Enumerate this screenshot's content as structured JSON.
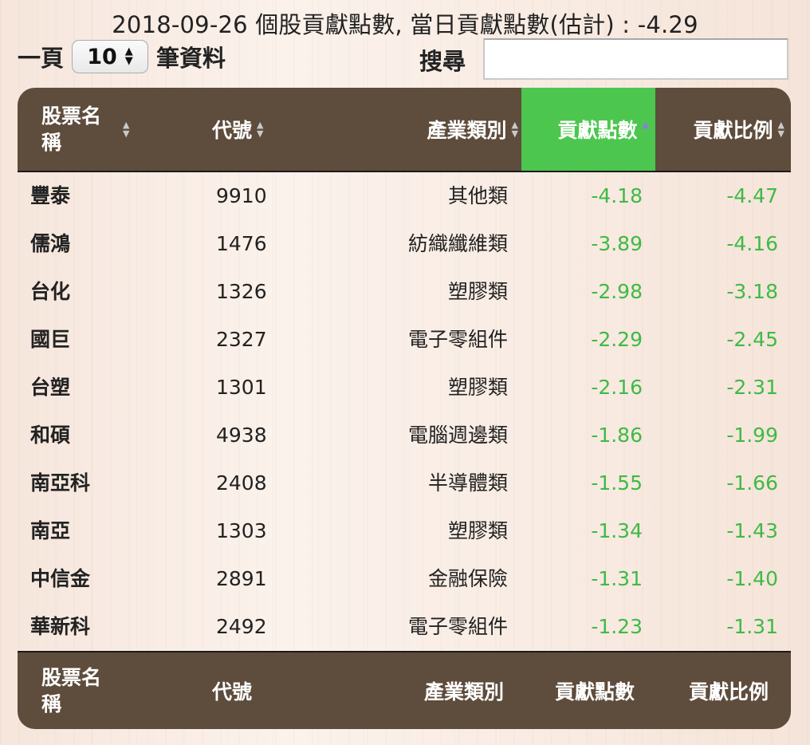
{
  "title": "2018-09-26 個股貢獻點數, 當日貢獻點數(估計) : -4.29",
  "controls": {
    "per_page_prefix": "一頁",
    "per_page_value": "10",
    "per_page_suffix": "筆資料",
    "search_label": "搜尋",
    "search_value": ""
  },
  "columns": {
    "name": "股票名稱",
    "code": "代號",
    "industry": "產業類別",
    "points": "貢獻點數",
    "ratio": "貢獻比例"
  },
  "sort": {
    "column": "points",
    "direction": "asc"
  },
  "colors": {
    "header_bg": "#5e4c3c",
    "active_header_bg": "#4cc64f",
    "negative_value": "#3fba45"
  },
  "rows": [
    {
      "name": "豐泰",
      "code": "9910",
      "industry": "其他類",
      "points": "-4.18",
      "ratio": "-4.47"
    },
    {
      "name": "儒鴻",
      "code": "1476",
      "industry": "紡織纖維類",
      "points": "-3.89",
      "ratio": "-4.16"
    },
    {
      "name": "台化",
      "code": "1326",
      "industry": "塑膠類",
      "points": "-2.98",
      "ratio": "-3.18"
    },
    {
      "name": "國巨",
      "code": "2327",
      "industry": "電子零組件",
      "points": "-2.29",
      "ratio": "-2.45"
    },
    {
      "name": "台塑",
      "code": "1301",
      "industry": "塑膠類",
      "points": "-2.16",
      "ratio": "-2.31"
    },
    {
      "name": "和碩",
      "code": "4938",
      "industry": "電腦週邊類",
      "points": "-1.86",
      "ratio": "-1.99"
    },
    {
      "name": "南亞科",
      "code": "2408",
      "industry": "半導體類",
      "points": "-1.55",
      "ratio": "-1.66"
    },
    {
      "name": "南亞",
      "code": "1303",
      "industry": "塑膠類",
      "points": "-1.34",
      "ratio": "-1.43"
    },
    {
      "name": "中信金",
      "code": "2891",
      "industry": "金融保險",
      "points": "-1.31",
      "ratio": "-1.40"
    },
    {
      "name": "華新科",
      "code": "2492",
      "industry": "電子零組件",
      "points": "-1.23",
      "ratio": "-1.31"
    }
  ]
}
